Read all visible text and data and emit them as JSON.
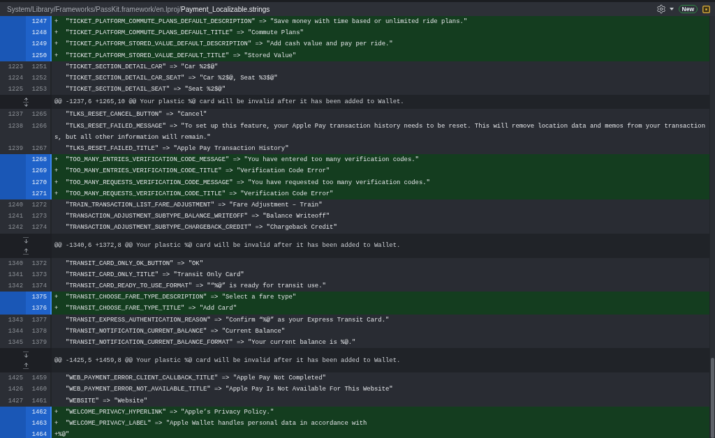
{
  "file": {
    "path": "System/Library/Frameworks/PassKit.framework/en.lproj/",
    "name": "Payment_Localizable.strings"
  },
  "toolbar": {
    "badge": "New"
  },
  "rows": [
    {
      "kind": "added",
      "new": "1247",
      "marker": "+",
      "text": "\"TICKET_PLATFORM_COMMUTE_PLANS_DEFAULT_DESCRIPTION\" => \"Save money with time based or unlimited ride plans.\""
    },
    {
      "kind": "added",
      "new": "1248",
      "marker": "+",
      "text": "\"TICKET_PLATFORM_COMMUTE_PLANS_DEFAULT_TITLE\" => \"Commute Plans\""
    },
    {
      "kind": "added",
      "new": "1249",
      "marker": "+",
      "text": "\"TICKET_PLATFORM_STORED_VALUE_DEFAULT_DESCRIPTION\" => \"Add cash value and pay per ride.\""
    },
    {
      "kind": "added",
      "new": "1250",
      "marker": "+",
      "text": "\"TICKET_PLATFORM_STORED_VALUE_DEFAULT_TITLE\" => \"Stored Value\""
    },
    {
      "kind": "context",
      "old": "1223",
      "new": "1251",
      "text": "\"TICKET_SECTION_DETAIL_CAR\" => \"Car %2$@\""
    },
    {
      "kind": "context",
      "old": "1224",
      "new": "1252",
      "text": "\"TICKET_SECTION_DETAIL_CAR_SEAT\" => \"Car %2$@, Seat %3$@\""
    },
    {
      "kind": "context",
      "old": "1225",
      "new": "1253",
      "text": "\"TICKET_SECTION_DETAIL_SEAT\" => \"Seat %2$@\""
    },
    {
      "kind": "hunk",
      "expanders": [
        {
          "kind": "unfold"
        }
      ],
      "text": "@@ -1237,6 +1265,10 @@ Your plastic %@ card will be invalid after it has been added to Wallet."
    },
    {
      "kind": "context",
      "old": "1237",
      "new": "1265",
      "text": "\"TLKS_RESET_CANCEL_BUTTON\" => \"Cancel\""
    },
    {
      "kind": "context",
      "old": "1238",
      "new": "1266",
      "text": "\"TLKS_RESET_FAILED_MESSAGE\" => \"To set up this feature, your Apple Pay transaction history needs to be reset. This will remove location data and memos from your transactions, but all other information will remain.\""
    },
    {
      "kind": "context",
      "old": "1239",
      "new": "1267",
      "text": "\"TLKS_RESET_FAILED_TITLE\" => \"Apple Pay Transaction History\""
    },
    {
      "kind": "added",
      "new": "1268",
      "marker": "+",
      "text": "\"TOO_MANY_ENTRIES_VERIFICATION_CODE_MESSAGE\" => \"You have entered too many verification codes.\""
    },
    {
      "kind": "added",
      "new": "1269",
      "marker": "+",
      "text": "\"TOO_MANY_ENTRIES_VERIFICATION_CODE_TITLE\" => \"Verification Code Error\""
    },
    {
      "kind": "added",
      "new": "1270",
      "marker": "+",
      "text": "\"TOO_MANY_REQUESTS_VERIFICATION_CODE_MESSAGE\" => \"You have requested too many verification codes.\""
    },
    {
      "kind": "added",
      "new": "1271",
      "marker": "+",
      "text": "\"TOO_MANY_REQUESTS_VERIFICATION_CODE_TITLE\" => \"Verification Code Error\""
    },
    {
      "kind": "context",
      "old": "1240",
      "new": "1272",
      "text": "\"TRAIN_TRANSACTION_LIST_FARE_ADJUSTMENT\" => \"Fare Adjustment – Train\""
    },
    {
      "kind": "context",
      "old": "1241",
      "new": "1273",
      "text": "\"TRANSACTION_ADJUSTMENT_SUBTYPE_BALANCE_WRITEOFF\" => \"Balance Writeoff\""
    },
    {
      "kind": "context",
      "old": "1242",
      "new": "1274",
      "text": "\"TRANSACTION_ADJUSTMENT_SUBTYPE_CHARGEBACK_CREDIT\" => \"Chargeback Credit\""
    },
    {
      "kind": "hunk",
      "expanders": [
        {
          "kind": "down"
        },
        {
          "kind": "up"
        }
      ],
      "text": "@@ -1340,6 +1372,8 @@ Your plastic %@ card will be invalid after it has been added to Wallet."
    },
    {
      "kind": "context",
      "old": "1340",
      "new": "1372",
      "text": "\"TRANSIT_CARD_ONLY_OK_BUTTON\" => \"OK\""
    },
    {
      "kind": "context",
      "old": "1341",
      "new": "1373",
      "text": "\"TRANSIT_CARD_ONLY_TITLE\" => \"Transit Only Card\""
    },
    {
      "kind": "context",
      "old": "1342",
      "new": "1374",
      "text": "\"TRANSIT_CARD_READY_TO_USE_FORMAT\" => \"“%@” is ready for transit use.\""
    },
    {
      "kind": "added",
      "new": "1375",
      "marker": "+",
      "text": "\"TRANSIT_CHOOSE_FARE_TYPE_DESCRIPTION\" => \"Select a fare type\""
    },
    {
      "kind": "added",
      "new": "1376",
      "marker": "+",
      "text": "\"TRANSIT_CHOOSE_FARE_TYPE_TITLE\" => \"Add Card\""
    },
    {
      "kind": "context",
      "old": "1343",
      "new": "1377",
      "text": "\"TRANSIT_EXPRESS_AUTHENTICATION_REASON\" => \"Confirm “%@” as your Express Transit Card.\""
    },
    {
      "kind": "context",
      "old": "1344",
      "new": "1378",
      "text": "\"TRANSIT_NOTIFICATION_CURRENT_BALANCE\" => \"Current Balance\""
    },
    {
      "kind": "context",
      "old": "1345",
      "new": "1379",
      "text": "\"TRANSIT_NOTIFICATION_CURRENT_BALANCE_FORMAT\" => \"Your current balance is %@.\""
    },
    {
      "kind": "hunk",
      "expanders": [
        {
          "kind": "down"
        },
        {
          "kind": "up"
        }
      ],
      "text": "@@ -1425,5 +1459,8 @@ Your plastic %@ card will be invalid after it has been added to Wallet."
    },
    {
      "kind": "context",
      "old": "1425",
      "new": "1459",
      "text": "\"WEB_PAYMENT_ERROR_CLIENT_CALLBACK_TITLE\" => \"Apple Pay Not Completed\""
    },
    {
      "kind": "context",
      "old": "1426",
      "new": "1460",
      "text": "\"WEB_PAYMENT_ERROR_NOT_AVAILABLE_TITLE\" => \"Apple Pay Is Not Available For This Website\""
    },
    {
      "kind": "context",
      "old": "1427",
      "new": "1461",
      "text": "\"WEBSITE\" => \"Website\""
    },
    {
      "kind": "added",
      "new": "1462",
      "marker": "+",
      "text": "\"WELCOME_PRIVACY_HYPERLINK\" => \"Apple’s Privacy Policy.\""
    },
    {
      "kind": "added",
      "new": "1463",
      "marker": "+",
      "text": "\"WELCOME_PRIVACY_LABEL\" => \"Apple Wallet handles personal data in accordance with"
    },
    {
      "kind": "added",
      "new": "1464",
      "text": "+%@\""
    }
  ]
}
